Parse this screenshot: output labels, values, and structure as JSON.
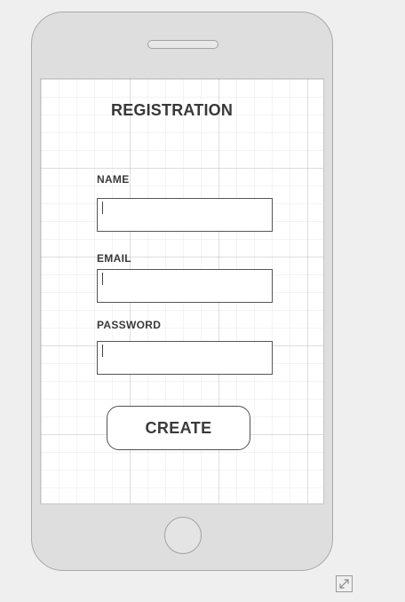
{
  "screen": {
    "title": "REGISTRATION"
  },
  "form": {
    "fields": [
      {
        "label": "NAME",
        "value": ""
      },
      {
        "label": "EMAIL",
        "value": ""
      },
      {
        "label": "PASSWORD",
        "value": ""
      }
    ],
    "submit_label": "CREATE"
  },
  "controls": {
    "expand_icon": "expand-diagonal-arrows"
  },
  "colors": {
    "page_background": "#efefef",
    "device_body": "#dedede",
    "screen_background": "#ffffff",
    "text": "#383838",
    "border": "#555555"
  }
}
